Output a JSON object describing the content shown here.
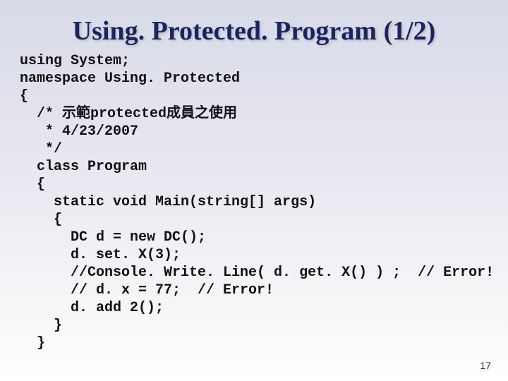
{
  "title": "Using. Protected. Program (1/2)",
  "code": "using System;\nnamespace Using. Protected\n{\n  /* 示範protected成員之使用\n   * 4/23/2007\n   */\n  class Program\n  {\n    static void Main(string[] args)\n    {\n      DC d = new DC();\n      d. set. X(3);\n      //Console. Write. Line( d. get. X() ) ;  // Error!\n      // d. x = 77;  // Error!\n      d. add 2();\n    }\n  }",
  "page_number": "17"
}
